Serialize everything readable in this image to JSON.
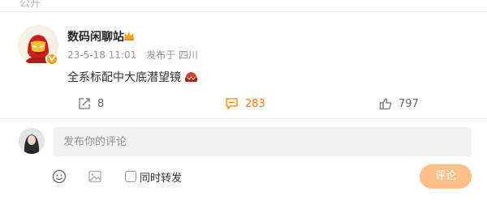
{
  "top_fragment": "公开",
  "post": {
    "author": "数码闲聊站",
    "date": "23-5-18 11:01",
    "source": "发布于 四川",
    "content": "全系标配中大底潜望镜",
    "content_emoji": "cake-icon",
    "actions": {
      "share_count": "8",
      "comment_count": "283",
      "like_count": "797"
    },
    "colors": {
      "comment_accent": "#ff8200",
      "verified_badge": "#f3a215"
    }
  },
  "composer": {
    "placeholder": "发布你的评论",
    "value": "",
    "repost_label": "同时转发",
    "repost_checked": false,
    "submit_label": "评论",
    "submit_color": "#ffc08a"
  }
}
